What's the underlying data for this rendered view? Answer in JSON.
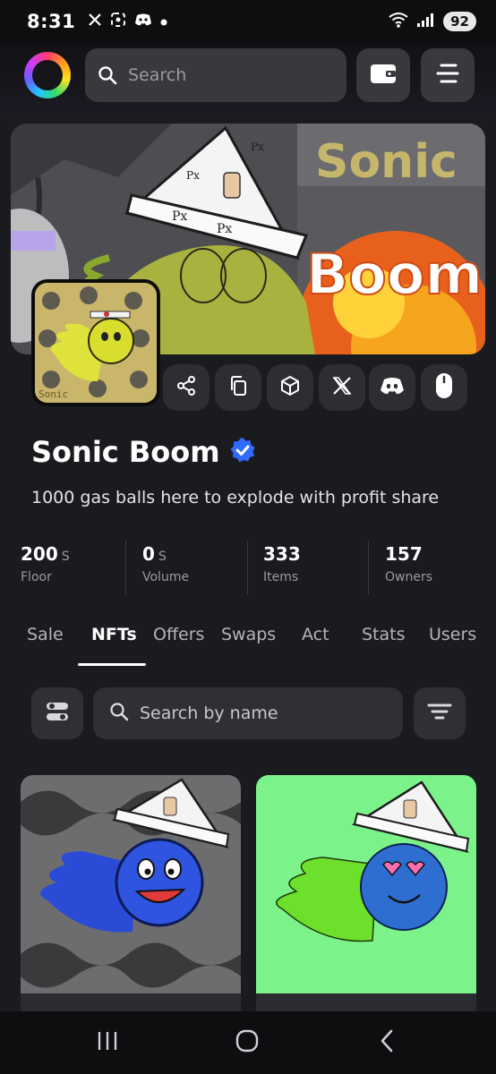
{
  "status_bar": {
    "time": "8:31",
    "notification_icons": [
      "x-logo-icon",
      "screenshot-icon",
      "discord-icon",
      "dot-icon"
    ],
    "signal_label": "6",
    "battery": "92"
  },
  "header": {
    "search_placeholder": "Search",
    "wallet_icon": "wallet-icon",
    "menu_icon": "menu-icon"
  },
  "banner": {
    "text_line1": "Sonic",
    "text_line2": "Boom"
  },
  "avatar": {
    "caption": "Sonic"
  },
  "social_buttons": [
    "share-icon",
    "copy-icon",
    "cube-icon",
    "x-logo-icon",
    "discord-icon",
    "mouse-icon"
  ],
  "collection": {
    "name": "Sonic Boom",
    "verified": true,
    "description": "1000 gas balls here to explode with profit share"
  },
  "stats": [
    {
      "value": "200",
      "unit": "S",
      "label": "Floor"
    },
    {
      "value": "0",
      "unit": "S",
      "label": "Volume"
    },
    {
      "value": "333",
      "unit": "",
      "label": "Items"
    },
    {
      "value": "157",
      "unit": "",
      "label": "Owners"
    }
  ],
  "tabs": [
    {
      "label": "Sale",
      "active": false
    },
    {
      "label": "NFTs",
      "active": true
    },
    {
      "label": "Offers",
      "active": false
    },
    {
      "label": "Swaps",
      "active": false
    },
    {
      "label": "Act",
      "active": false
    },
    {
      "label": "Stats",
      "active": false
    },
    {
      "label": "Users",
      "active": false
    }
  ],
  "filters": {
    "name_search_placeholder": "Search by name"
  },
  "nft_cards": [
    {
      "background": "grey-noise-waves",
      "character": "blue-flame-ball"
    },
    {
      "background": "#7cf38a",
      "character": "blue-green-flame-ball"
    }
  ],
  "colors": {
    "background": "#1a1b1f",
    "surface": "#2f2f34",
    "verified_badge": "#2f6bff",
    "card2_bg": "#7cf38a"
  }
}
